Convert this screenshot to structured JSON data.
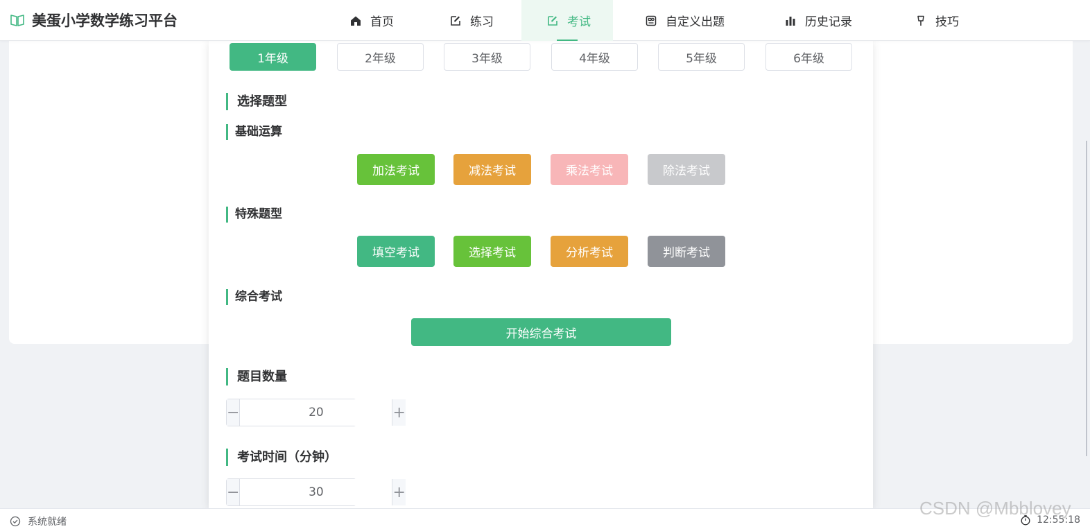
{
  "header": {
    "brand_title": "美蛋小学数学练习平台",
    "nav": [
      {
        "label": "首页",
        "icon": "home-icon"
      },
      {
        "label": "练习",
        "icon": "edit-icon"
      },
      {
        "label": "考试",
        "icon": "edit-icon",
        "active": true
      },
      {
        "label": "自定义出题",
        "icon": "custom-icon"
      },
      {
        "label": "历史记录",
        "icon": "bar-chart-icon"
      },
      {
        "label": "技巧",
        "icon": "lightbulb-icon"
      }
    ]
  },
  "exam": {
    "grades": [
      "1年级",
      "2年级",
      "3年级",
      "4年级",
      "5年级",
      "6年级"
    ],
    "selected_grade": "1年级",
    "choose_type_title": "选择题型",
    "basic_title": "基础运算",
    "basic_buttons": [
      "加法考试",
      "减法考试",
      "乘法考试",
      "除法考试"
    ],
    "special_title": "特殊题型",
    "special_buttons": [
      "填空考试",
      "选择考试",
      "分析考试",
      "判断考试"
    ],
    "comprehensive_title": "综合考试",
    "start_button": "开始综合考试",
    "question_count_title": "题目数量",
    "question_count": "20",
    "time_title": "考试时间（分钟）",
    "time_minutes": "30"
  },
  "colors": {
    "primary": "#42b883",
    "addition": "#67c23a",
    "subtraction": "#e6a23c",
    "multiplication": "#f8b6b8",
    "division": "#c8c9cc",
    "fill_blank": "#42b883",
    "choice": "#67c23a",
    "analysis": "#e6a23c",
    "judgement": "#909399"
  },
  "statusbar": {
    "left_text": "系统就绪",
    "time": "12:55:18"
  },
  "watermark": "CSDN @Mbblovey"
}
